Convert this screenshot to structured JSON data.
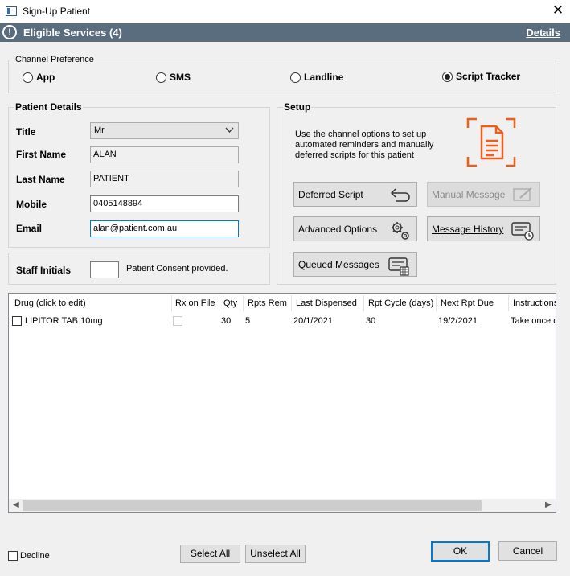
{
  "window": {
    "title": "Sign-Up Patient",
    "close_glyph": "✕"
  },
  "banner": {
    "icon_glyph": "!",
    "title": "Eligible Services (4)",
    "link": "Details"
  },
  "channel": {
    "label": "Channel Preference",
    "options": [
      {
        "label": "App",
        "checked": false
      },
      {
        "label": "SMS",
        "checked": false
      },
      {
        "label": "Landline",
        "checked": false
      },
      {
        "label": "Script Tracker",
        "checked": true
      }
    ]
  },
  "patient": {
    "label": "Patient Details",
    "title_label": "Title",
    "title_value": "Mr",
    "first_label": "First Name",
    "first_value": "ALAN",
    "last_label": "Last Name",
    "last_value": "PATIENT",
    "mobile_label": "Mobile",
    "mobile_value": "0405148894",
    "email_label": "Email",
    "email_value": "alan@patient.com.au"
  },
  "staff": {
    "label": "Staff Initials",
    "value": "",
    "consent": "Patient Consent provided."
  },
  "setup": {
    "label": "Setup",
    "text1": "Use the channel options to set up",
    "text2": "automated reminders and manually",
    "text3": "deferred scripts for this patient",
    "buttons": {
      "deferred": "Deferred Script",
      "manual": "Manual Message",
      "advanced": "Advanced Options",
      "history": "Message History",
      "queued": "Queued Messages"
    }
  },
  "grid": {
    "columns": [
      "Drug (click to edit)",
      "Rx on File",
      "Qty",
      "Rpts Rem",
      "Last Dispensed",
      "Rpt Cycle (days)",
      "Next Rpt Due",
      "Instructions"
    ],
    "rows": [
      {
        "drug": "LIPITOR TAB 10mg",
        "qty": "30",
        "rpts": "5",
        "last": "20/1/2021",
        "cycle": "30",
        "next": "19/2/2021",
        "instr": "Take once d"
      }
    ]
  },
  "footer": {
    "decline": "Decline",
    "select_all": "Select All",
    "unselect_all": "Unselect All",
    "ok": "OK",
    "cancel": "Cancel"
  },
  "colors": {
    "banner": "#5a6d7f",
    "accent": "#e8601c"
  }
}
